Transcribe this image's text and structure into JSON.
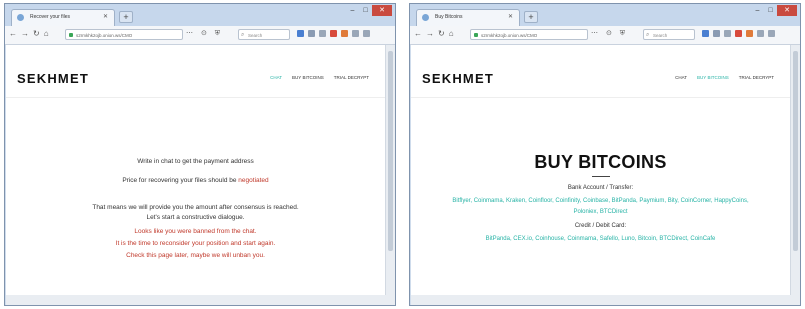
{
  "left_window": {
    "tab_title": "Recover your files",
    "url": "s2rmkhk2ojb.onion.ws/CMO",
    "search_placeholder": "Search",
    "logo": "SEKHMET",
    "menu": [
      "CHAT",
      "BUY BITCOINS",
      "TRIAL DECRYPT"
    ],
    "lines": {
      "l1": "Write in chat to get the payment address",
      "l2_prefix": "Price for recovering your files should be ",
      "l2_link": "negotiated",
      "l3": "That means we will provide you the amount after consensus is reached.",
      "l4": "Let's start a constructive dialogue.",
      "r1": "Looks like you were banned from the chat.",
      "r2": "It is the time to reconsider your position and start again.",
      "r3": "Check this page later, maybe we will unban you."
    }
  },
  "right_window": {
    "tab_title": "Buy Bitcoins",
    "url": "s2rmkhk2ojb.onion.ws/CMO",
    "search_placeholder": "Search",
    "logo": "SEKHMET",
    "menu": [
      "CHAT",
      "BUY BITCOINS",
      "TRIAL DECRYPT"
    ],
    "heading": "BUY BITCOINS",
    "bank_label": "Bank Account / Transfer:",
    "bank_links_1": "Bitflyer, Coinmama, Kraken, Coinfloor, Coinfinity, Coinbase, BitPanda, Paymium, Bity, CoinCorner, HappyCoins,",
    "bank_links_2": "Poloniex, BTCDirect",
    "card_label": "Credit / Debit Card:",
    "card_links": "BitPanda, CEX.io, Coinhouse, Coinmama, Safello, Luno, Bitcoin, BTCDirect, CoinCafe"
  },
  "colors": {
    "accent": "#27b3a6",
    "warning": "#c0392b",
    "close": "#c94a3f"
  },
  "icons": [
    "back-icon",
    "forward-icon",
    "reload-icon",
    "home-icon",
    "lock-icon",
    "search-icon",
    "bookmark-icon"
  ]
}
